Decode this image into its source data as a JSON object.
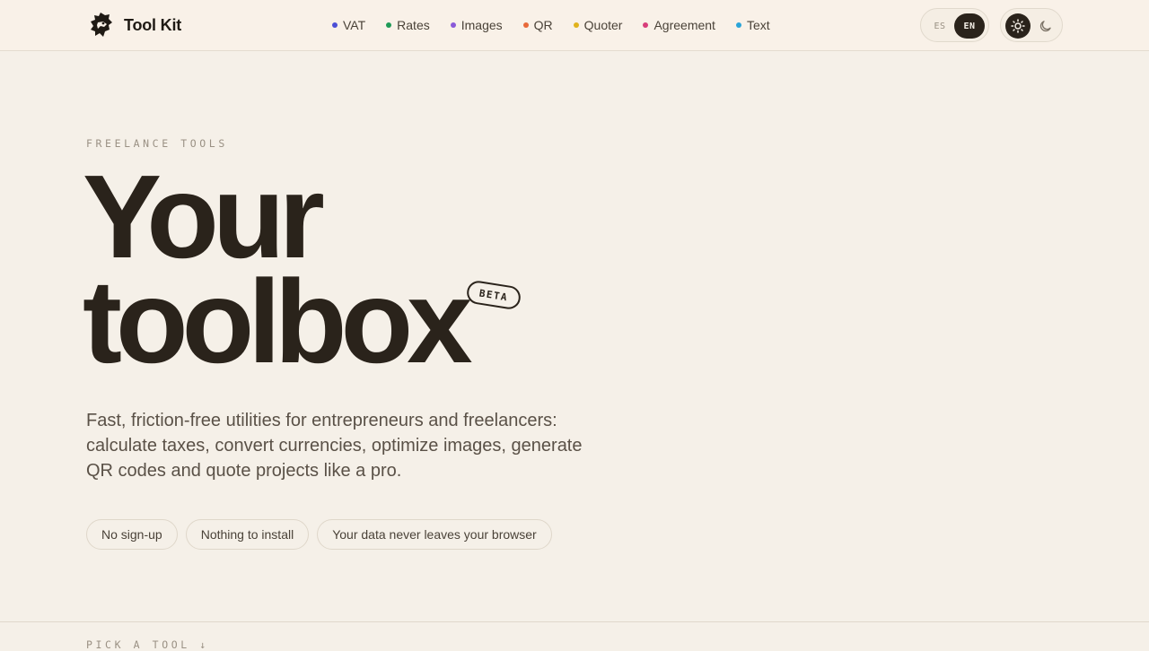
{
  "brand": {
    "name": "Tool Kit",
    "logo_icon": "lion-head-icon"
  },
  "nav": [
    {
      "label": "VAT",
      "color": "#4c4fd6"
    },
    {
      "label": "Rates",
      "color": "#1f9a57"
    },
    {
      "label": "Images",
      "color": "#8a5ad8"
    },
    {
      "label": "QR",
      "color": "#e8693a"
    },
    {
      "label": "Quoter",
      "color": "#e0b21c"
    },
    {
      "label": "Agreement",
      "color": "#d83e7a"
    },
    {
      "label": "Text",
      "color": "#2aa4d8"
    }
  ],
  "language": {
    "options": [
      "ES",
      "EN"
    ],
    "selected": "EN"
  },
  "theme": {
    "selected": "light",
    "light_icon": "sun-icon",
    "dark_icon": "moon-icon"
  },
  "hero": {
    "eyebrow": "FREELANCE TOOLS",
    "title_line1": "Your",
    "title_line2": "toolbox",
    "badge": "BETA",
    "lead": "Fast, friction-free utilities for entrepreneurs and freelancers: calculate taxes, convert currencies, optimize images, generate QR codes and quote projects like a pro.",
    "pills": [
      "No sign-up",
      "Nothing to install",
      "Your data never leaves your browser"
    ]
  },
  "section": {
    "label": "PICK A TOOL ↓"
  }
}
